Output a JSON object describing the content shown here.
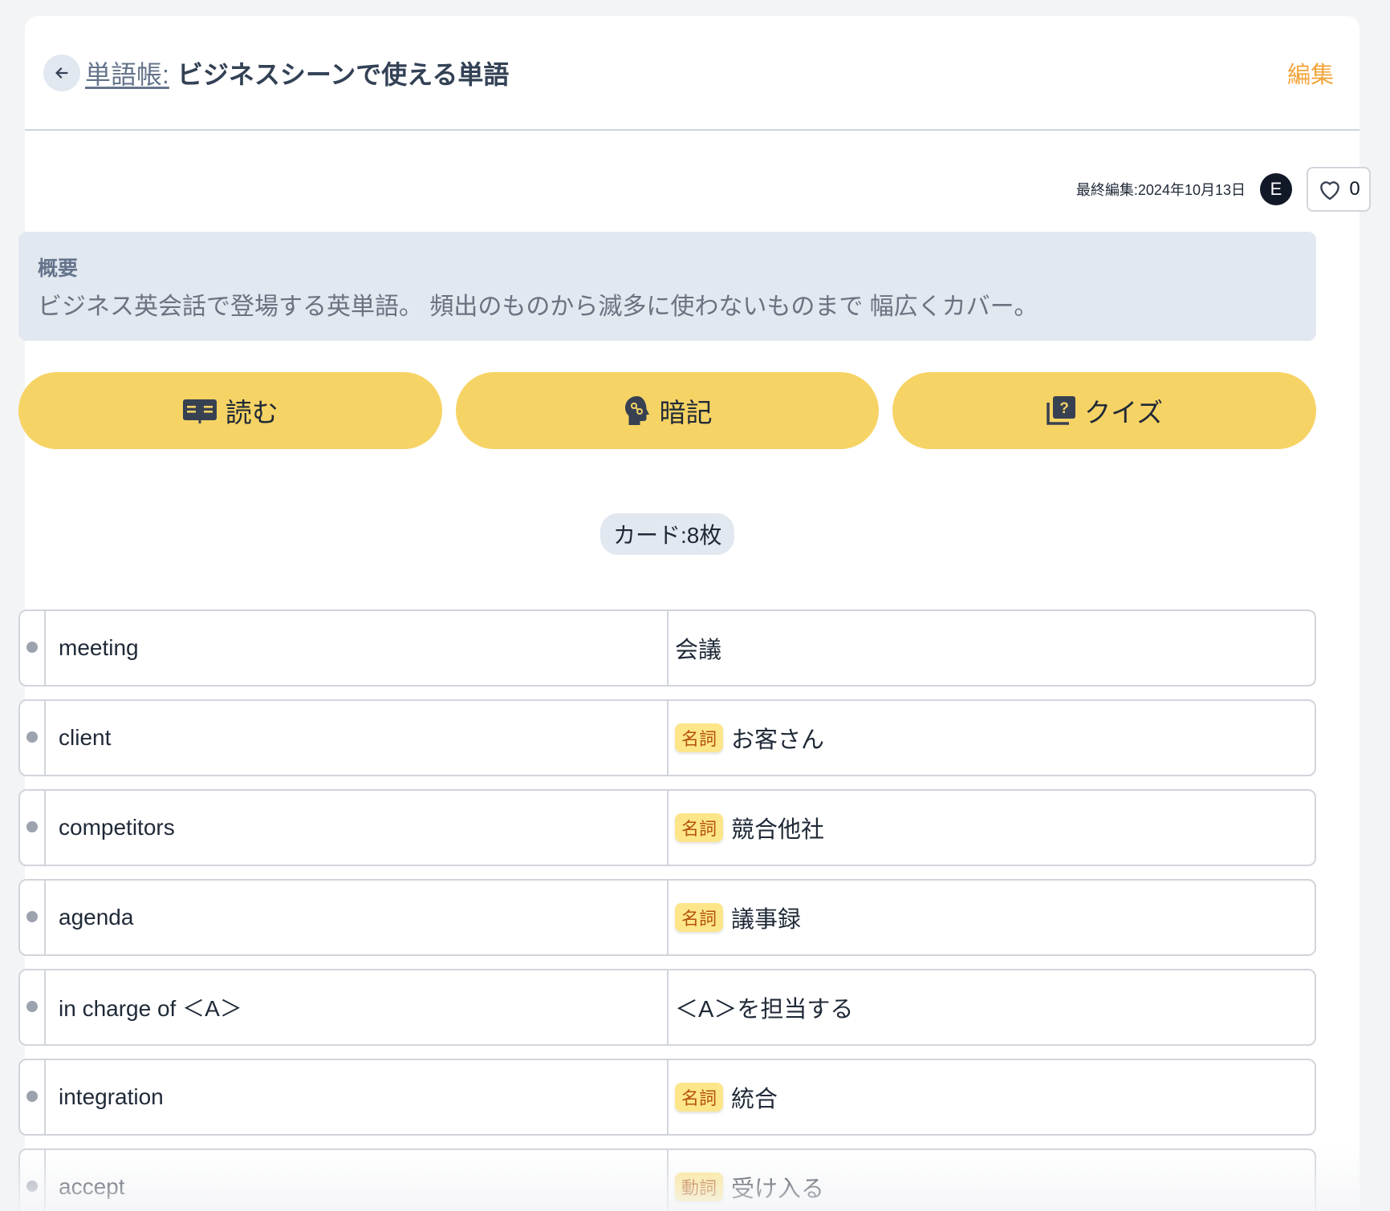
{
  "header": {
    "breadcrumb": "単語帳:",
    "title": "ビジネスシーンで使える単語",
    "edit_label": "編集"
  },
  "meta": {
    "last_edited": "最終編集:2024年10月13日",
    "avatar_initial": "E",
    "like_count": "0"
  },
  "summary": {
    "label": "概要",
    "text": "ビジネス英会話で登場する英単語。 頻出のものから滅多に使わないものまで 幅広くカバー。"
  },
  "actions": {
    "read": "読む",
    "memorize": "暗記",
    "quiz": "クイズ"
  },
  "card_count": "カード:8枚",
  "cards": [
    {
      "term": "meeting",
      "pos": "",
      "definition": "会議"
    },
    {
      "term": "client",
      "pos": "名詞",
      "definition": "お客さん"
    },
    {
      "term": "competitors",
      "pos": "名詞",
      "definition": "競合他社"
    },
    {
      "term": "agenda",
      "pos": "名詞",
      "definition": "議事録"
    },
    {
      "term": "in charge of ＜A＞",
      "pos": "",
      "definition": "＜A＞を担当する"
    },
    {
      "term": "integration",
      "pos": "名詞",
      "definition": "統合"
    },
    {
      "term": "accept",
      "pos": "動詞",
      "definition": "受け入る"
    }
  ],
  "colors": {
    "accent": "#f6d365",
    "edit_link": "#f2a43a",
    "pos_badge_bg": "#fde68a",
    "pos_badge_text": "#b45309"
  }
}
